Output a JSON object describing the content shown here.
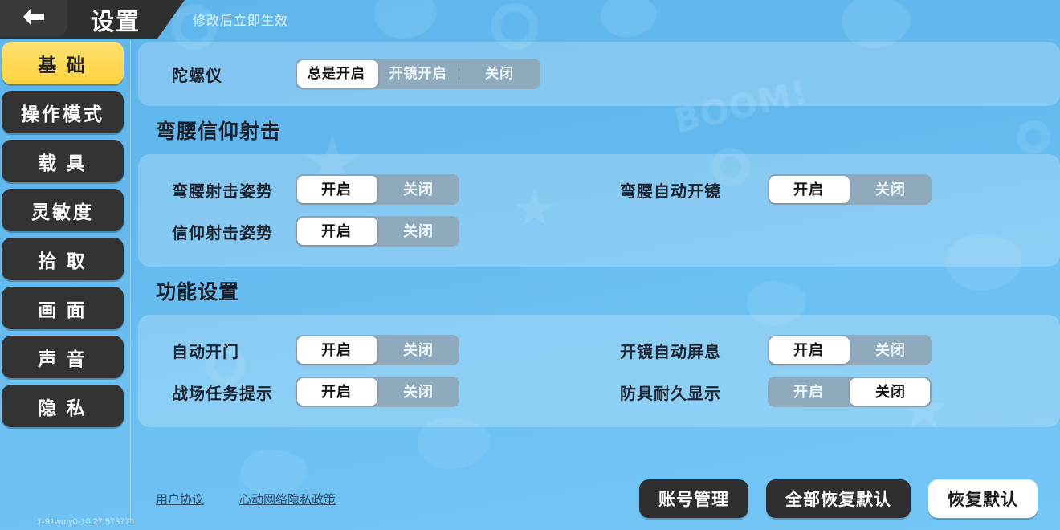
{
  "header": {
    "title": "设置",
    "note": "修改后立即生效",
    "back_icon": "arrow-left-icon"
  },
  "sidebar": {
    "version": "1-91wmy0-10.27.573771",
    "items": [
      {
        "label": "基 础",
        "active": true
      },
      {
        "label": "操作模式",
        "active": false
      },
      {
        "label": "载 具",
        "active": false
      },
      {
        "label": "灵敏度",
        "active": false
      },
      {
        "label": "拾 取",
        "active": false
      },
      {
        "label": "画 面",
        "active": false
      },
      {
        "label": "声 音",
        "active": false
      },
      {
        "label": "隐 私",
        "active": false
      }
    ]
  },
  "sections": [
    {
      "title": "",
      "rows": [
        {
          "left": {
            "label": "陀螺仪",
            "options": [
              "总是开启",
              "开镜开启",
              "关闭"
            ],
            "selected": 0,
            "divider_after": 1
          },
          "right": null
        }
      ]
    },
    {
      "title": "弯腰信仰射击",
      "rows": [
        {
          "left": {
            "label": "弯腰射击姿势",
            "options": [
              "开启",
              "关闭"
            ],
            "selected": 0
          },
          "right": {
            "label": "弯腰自动开镜",
            "options": [
              "开启",
              "关闭"
            ],
            "selected": 0
          }
        },
        {
          "left": {
            "label": "信仰射击姿势",
            "options": [
              "开启",
              "关闭"
            ],
            "selected": 0
          },
          "right": null
        }
      ]
    },
    {
      "title": "功能设置",
      "rows": [
        {
          "left": {
            "label": "自动开门",
            "options": [
              "开启",
              "关闭"
            ],
            "selected": 0
          },
          "right": {
            "label": "开镜自动屏息",
            "options": [
              "开启",
              "关闭"
            ],
            "selected": 0
          }
        },
        {
          "left": {
            "label": "战场任务提示",
            "options": [
              "开启",
              "关闭"
            ],
            "selected": 0
          },
          "right": {
            "label": "防具耐久显示",
            "options": [
              "开启",
              "关闭"
            ],
            "selected": 1
          }
        }
      ]
    }
  ],
  "footer": {
    "links": [
      "用户协议",
      "心动网络隐私政策"
    ],
    "buttons": [
      {
        "label": "账号管理",
        "style": "dark"
      },
      {
        "label": "全部恢复默认",
        "style": "dark"
      },
      {
        "label": "恢复默认",
        "style": "light"
      }
    ]
  },
  "decor": {
    "boom_text": "BOOM!"
  },
  "colors": {
    "background_top": "#5fb6ec",
    "background_bottom": "#74c6f5",
    "header_dark": "#2f2f2f",
    "tab_active": "#ffd33f",
    "tab_inactive": "#333333",
    "toggle_track": "#8fa9bd",
    "toggle_pill": "#ffffff",
    "panel_fill": "rgba(255,255,255,0.22)"
  }
}
